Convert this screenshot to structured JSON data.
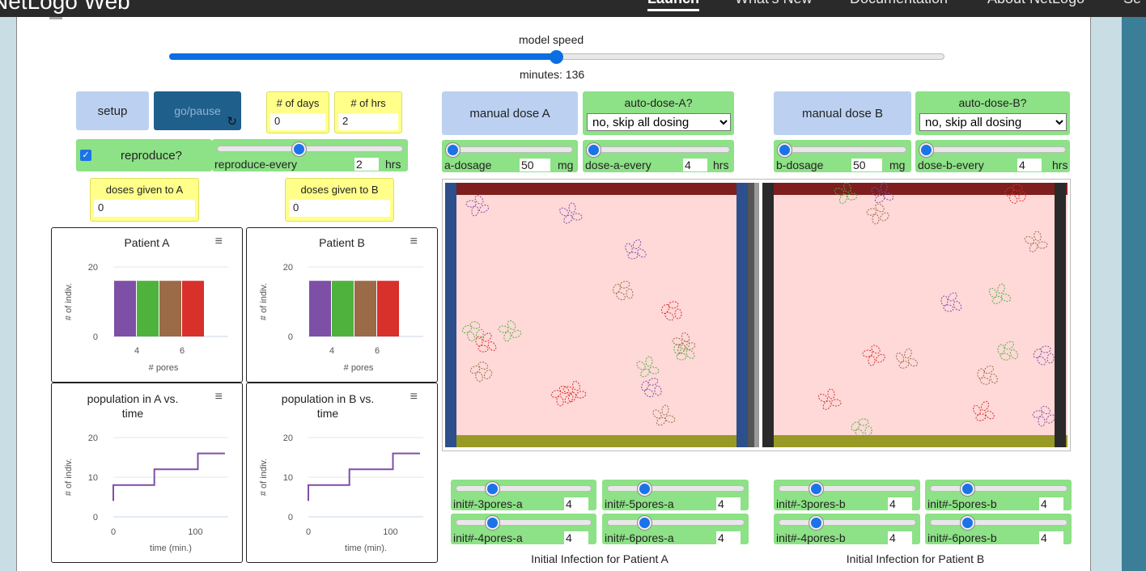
{
  "topbar": {
    "brand": "NetLogo Web",
    "nav": [
      "Launch",
      "What's New",
      "Documentation",
      "About NetLogo",
      "Se"
    ]
  },
  "speed": {
    "label": "model speed",
    "minutes_label": "minutes: 136",
    "value_fraction": 0.5
  },
  "buttons": {
    "setup": "setup",
    "go": "go/pause",
    "manual_a": "manual dose A",
    "manual_b": "manual dose B"
  },
  "inputs": {
    "days": {
      "label": "# of days",
      "value": "0"
    },
    "hrs": {
      "label": "# of hrs",
      "value": "2"
    }
  },
  "reproduce": {
    "label": "reproduce?",
    "checked": true
  },
  "reproduce_every": {
    "label": "reproduce-every",
    "value": "2",
    "units": "hrs",
    "fraction": 0.5
  },
  "auto_dose_a": {
    "label": "auto-dose-A?",
    "selected": "no, skip all dosing"
  },
  "auto_dose_b": {
    "label": "auto-dose-B?",
    "selected": "no, skip all dosing"
  },
  "a_dosage": {
    "label": "a-dosage",
    "value": "50",
    "units": "mg",
    "fraction": 0.0
  },
  "dose_a_every": {
    "label": "dose-a-every",
    "value": "4",
    "units": "hrs",
    "fraction": 0.0
  },
  "b_dosage": {
    "label": "b-dosage",
    "value": "50",
    "units": "mg",
    "fraction": 0.0
  },
  "dose_b_every": {
    "label": "dose-b-every",
    "value": "4",
    "units": "hrs",
    "fraction": 0.0
  },
  "monitors": {
    "doses_a": {
      "label": "doses given to A",
      "value": "0"
    },
    "doses_b": {
      "label": "doses given to B",
      "value": "0"
    }
  },
  "init": {
    "a3": {
      "label": "init#-3pores-a",
      "value": "4",
      "fraction": 0.25
    },
    "a5": {
      "label": "init#-5pores-a",
      "value": "4",
      "fraction": 0.25
    },
    "a4": {
      "label": "init#-4pores-a",
      "value": "4",
      "fraction": 0.25
    },
    "a6": {
      "label": "init#-6pores-a",
      "value": "4",
      "fraction": 0.25
    },
    "b3": {
      "label": "init#-3pores-b",
      "value": "4",
      "fraction": 0.25
    },
    "b5": {
      "label": "init#-5pores-b",
      "value": "4",
      "fraction": 0.25
    },
    "b4": {
      "label": "init#-4pores-b",
      "value": "4",
      "fraction": 0.25
    },
    "b6": {
      "label": "init#-6pores-b",
      "value": "4",
      "fraction": 0.25
    }
  },
  "captions": {
    "a": "Initial Infection for Patient A",
    "b": "Initial Infection for Patient B"
  },
  "colors": {
    "purple": "#7e4fa6",
    "green": "#4fb23c",
    "brown": "#9b6a46",
    "red": "#d8302b",
    "world_bg": "#ffd8d8",
    "world_top": "#7e1e1e",
    "world_bottom": "#999a25"
  },
  "chart_data": [
    {
      "type": "bar",
      "title": "Patient A",
      "xlabel": "# pores",
      "ylabel": "# of indiv.",
      "x_ticks": [
        "4",
        "6"
      ],
      "y_ticks": [
        "0",
        "20"
      ],
      "ylim": [
        0,
        20
      ],
      "categories": [
        "3",
        "4",
        "5",
        "6"
      ],
      "values": [
        16,
        16,
        16,
        16
      ],
      "bar_colors": [
        "#7e4fa6",
        "#4fb23c",
        "#9b6a46",
        "#d8302b"
      ]
    },
    {
      "type": "bar",
      "title": "Patient B",
      "xlabel": "# pores",
      "ylabel": "# of indiv.",
      "x_ticks": [
        "4",
        "6"
      ],
      "y_ticks": [
        "0",
        "20"
      ],
      "ylim": [
        0,
        20
      ],
      "categories": [
        "3",
        "4",
        "5",
        "6"
      ],
      "values": [
        16,
        16,
        16,
        16
      ],
      "bar_colors": [
        "#7e4fa6",
        "#4fb23c",
        "#9b6a46",
        "#d8302b"
      ]
    },
    {
      "type": "line",
      "title": "population in A vs. time",
      "xlabel": "time (min.)",
      "ylabel": "# of indiv.",
      "x_ticks": [
        "0",
        "100"
      ],
      "y_ticks": [
        "0",
        "10",
        "20"
      ],
      "xlim": [
        0,
        140
      ],
      "ylim": [
        0,
        20
      ],
      "x": [
        0,
        0,
        50,
        50,
        103,
        103,
        136
      ],
      "y": [
        4,
        8,
        8,
        12,
        12,
        16,
        16
      ]
    },
    {
      "type": "line",
      "title": "population in B vs. time",
      "xlabel": "time (min).",
      "ylabel": "# of indiv.",
      "x_ticks": [
        "0",
        "100"
      ],
      "y_ticks": [
        "0",
        "10",
        "20"
      ],
      "xlim": [
        0,
        140
      ],
      "ylim": [
        0,
        20
      ],
      "x": [
        0,
        0,
        50,
        50,
        103,
        103,
        136
      ],
      "y": [
        4,
        8,
        8,
        12,
        12,
        16,
        16
      ]
    }
  ]
}
